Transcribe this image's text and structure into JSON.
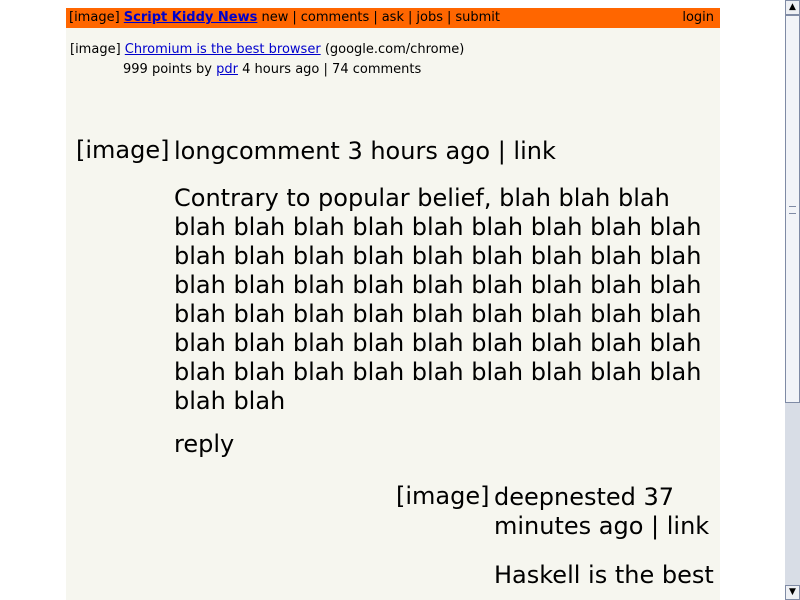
{
  "topbar": {
    "logo_placeholder": "[image]",
    "site_name": "Script Kiddy News",
    "nav": [
      "new",
      "comments",
      "ask",
      "jobs",
      "submit"
    ],
    "login": "login",
    "colors": {
      "background": "#ff6600",
      "link": "#0000cc"
    }
  },
  "story": {
    "vote_placeholder": "[image]",
    "title": "Chromium is the best browser",
    "domain": "(google.com/chrome)",
    "points": "999 points",
    "by_label": "by",
    "author": "pdr",
    "age": "4 hours ago",
    "separator": "|",
    "comments": "74 comments"
  },
  "comments": [
    {
      "indent_placeholder": "[image]",
      "header": "longcomment 3 hours ago | link",
      "body": "Contrary to popular belief, blah blah blah blah blah blah blah blah blah blah blah blah blah blah blah blah blah blah blah blah blah blah blah blah blah blah blah blah blah blah blah blah blah blah blah blah blah blah blah blah blah blah blah blah blah blah blah blah blah blah blah blah blah blah blah blah blah blah blah",
      "reply": "reply"
    },
    {
      "indent_placeholder": "[image]",
      "header": "deepnested 37 minutes ago | link",
      "body": "Haskell is the best"
    }
  ],
  "scrollbar": {
    "up_icon": "arrow-up-icon",
    "down_icon": "arrow-down-icon"
  }
}
